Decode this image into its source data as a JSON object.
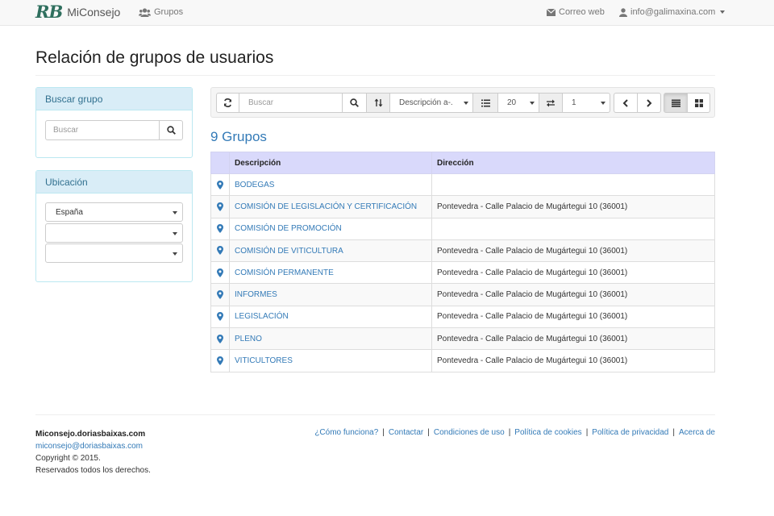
{
  "navbar": {
    "logo": "RB",
    "app_name": "MiConsejo",
    "groups_link": "Grupos",
    "webmail_link": "Correo web",
    "user_email": "info@galimaxina.com"
  },
  "page": {
    "title": "Relación de grupos de usuarios"
  },
  "search_panel": {
    "title": "Buscar grupo",
    "placeholder": "Buscar"
  },
  "location_panel": {
    "title": "Ubicación",
    "country": "España",
    "region": "",
    "city": ""
  },
  "toolbar": {
    "search_placeholder": "Buscar",
    "sort_value": "Descripción a-.",
    "page_size": "20",
    "page_number": "1"
  },
  "results": {
    "count_label": "9 Grupos",
    "columns": [
      "Descripción",
      "Dirección"
    ],
    "rows": [
      {
        "description": "BODEGAS",
        "address": ""
      },
      {
        "description": "COMISIÓN DE LEGISLACIÓN Y CERTIFICACIÓN",
        "address": "Pontevedra - Calle Palacio de Mugártegui 10 (36001)"
      },
      {
        "description": "COMISIÓN DE PROMOCIÓN",
        "address": ""
      },
      {
        "description": "COMISIÓN DE VITICULTURA",
        "address": "Pontevedra - Calle Palacio de Mugártegui 10 (36001)"
      },
      {
        "description": "COMISIÓN PERMANENTE",
        "address": "Pontevedra - Calle Palacio de Mugártegui 10 (36001)"
      },
      {
        "description": "INFORMES",
        "address": "Pontevedra - Calle Palacio de Mugártegui 10 (36001)"
      },
      {
        "description": "LEGISLACIÓN",
        "address": "Pontevedra - Calle Palacio de Mugártegui 10 (36001)"
      },
      {
        "description": "PLENO",
        "address": "Pontevedra - Calle Palacio de Mugártegui 10 (36001)"
      },
      {
        "description": "VITICULTORES",
        "address": "Pontevedra - Calle Palacio de Mugártegui 10 (36001)"
      }
    ]
  },
  "footer": {
    "site": "Miconsejo.doriasbaixas.com",
    "email": "miconsejo@doriasbaixas.com",
    "copyright": "Copyright © 2015.",
    "rights": "Reservados todos los derechos.",
    "links": [
      "¿Cómo funciona?",
      "Contactar",
      "Condiciones de uso",
      "Política de cookies",
      "Política de privacidad",
      "Acerca de"
    ]
  },
  "colors": {
    "link": "#337ab7",
    "panel_head": "#d9edf7",
    "table_head": "#d9d9fb"
  }
}
